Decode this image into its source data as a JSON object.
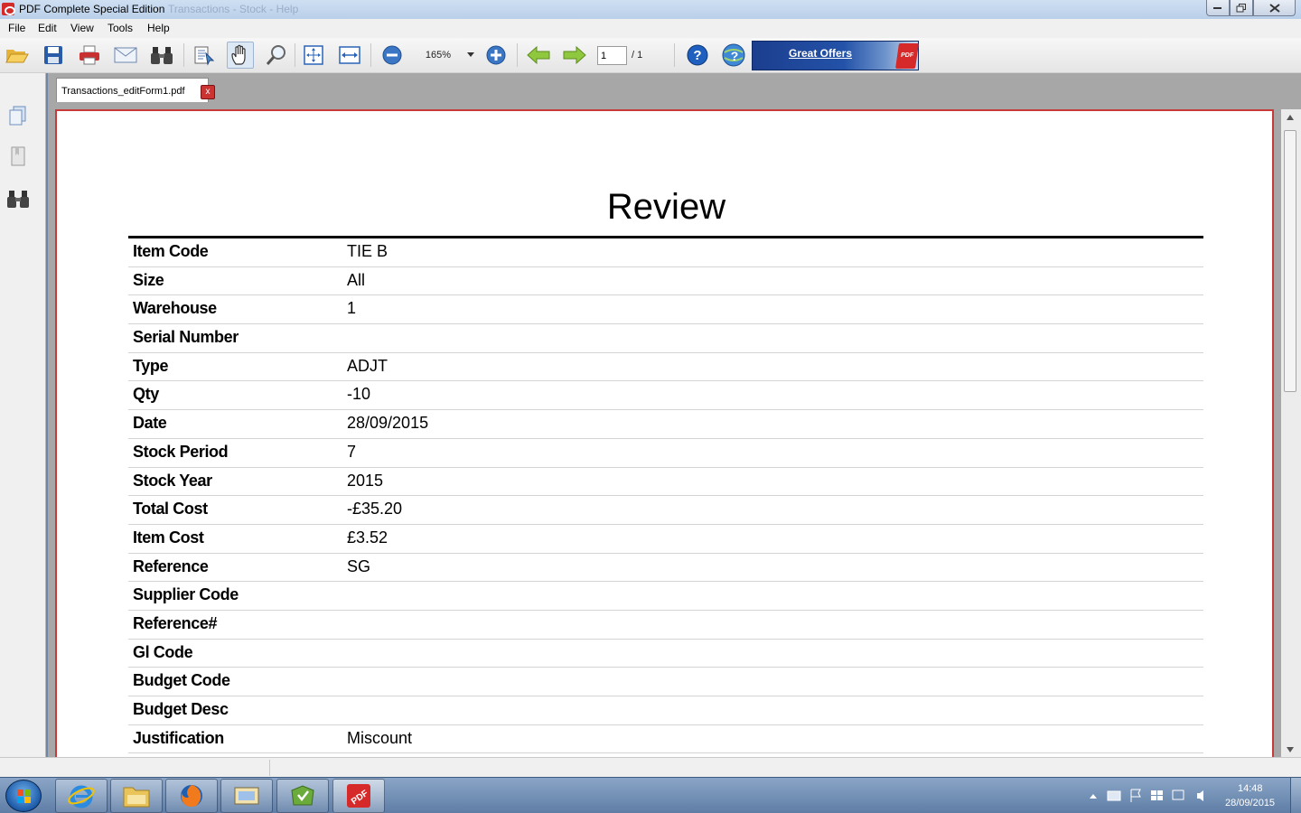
{
  "window": {
    "title": "PDF Complete Special Edition",
    "ghost_title": "Transactions - Stock - Help"
  },
  "menu": [
    "File",
    "Edit",
    "View",
    "Tools",
    "Help"
  ],
  "toolbar": {
    "zoom": "165%",
    "page_current": "1",
    "page_total": "/ 1",
    "offers_label": "Great Offers",
    "offers_badge": "PDF"
  },
  "tab": {
    "label": "Transactions_editForm1.pdf",
    "close": "x"
  },
  "document": {
    "title": "Review",
    "rows": [
      {
        "label": "Item Code",
        "value": "TIE B"
      },
      {
        "label": "Size",
        "value": "All"
      },
      {
        "label": "Warehouse",
        "value": "1"
      },
      {
        "label": "Serial Number",
        "value": ""
      },
      {
        "label": "Type",
        "value": "ADJT"
      },
      {
        "label": "Qty",
        "value": "-10"
      },
      {
        "label": "Date",
        "value": "28/09/2015"
      },
      {
        "label": "Stock Period",
        "value": "7"
      },
      {
        "label": "Stock Year",
        "value": "2015"
      },
      {
        "label": "Total Cost",
        "value": "-£35.20"
      },
      {
        "label": "Item Cost",
        "value": "£3.52"
      },
      {
        "label": "Reference",
        "value": "SG"
      },
      {
        "label": "Supplier Code",
        "value": ""
      },
      {
        "label": "Reference#",
        "value": ""
      },
      {
        "label": "Gl Code",
        "value": ""
      },
      {
        "label": "Budget Code",
        "value": ""
      },
      {
        "label": "Budget Desc",
        "value": ""
      },
      {
        "label": "Justification",
        "value": "Miscount"
      }
    ]
  },
  "taskbar": {
    "time": "14:48",
    "date": "28/09/2015",
    "apps": [
      "internet-explorer",
      "file-explorer",
      "firefox",
      "email-app",
      "green-app",
      "pdf-complete"
    ]
  },
  "colors": {
    "page_border": "#c83a3a",
    "offers_bg": "#1c3e8e",
    "doc_bg": "#a7a7a7"
  }
}
